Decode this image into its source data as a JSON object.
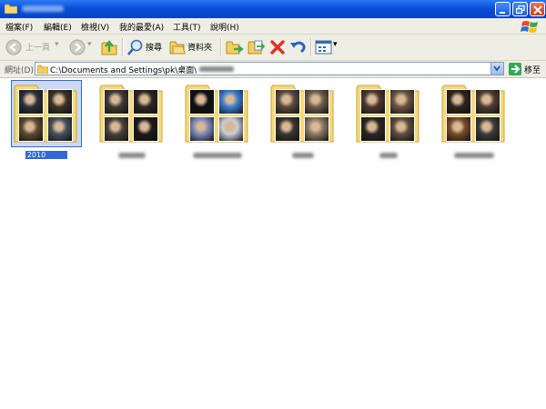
{
  "window": {
    "title": "",
    "buttons": {
      "minimize": "minimize",
      "maximize": "maximize",
      "close": "close"
    }
  },
  "menu": [
    "檔案(F)",
    "編輯(E)",
    "檢視(V)",
    "我的最愛(A)",
    "工具(T)",
    "說明(H)"
  ],
  "toolbar": {
    "back_label": "上一頁",
    "search_label": "搜尋",
    "folders_label": "資料夾"
  },
  "address": {
    "label": "網址(D)",
    "path": "C:\\Documents and Settings\\pk\\桌面\\",
    "go_label": "移至"
  },
  "folders": [
    {
      "label": "2010",
      "selected": true,
      "thumbs": [
        "#2b2f3a",
        "#3a3228",
        "#5c4a30",
        "#44505c"
      ]
    },
    {
      "label": "",
      "selected": false,
      "thumbs": [
        "#3d3a36",
        "#2a2724",
        "#4a4038",
        "#1c1a19"
      ]
    },
    {
      "label": "",
      "selected": false,
      "thumbs": [
        "#0f1014",
        "#3b7fd0",
        "#7c88b8",
        "#c8ccd8"
      ]
    },
    {
      "label": "",
      "selected": false,
      "thumbs": [
        "#5a4a3e",
        "#6e5c4c",
        "#3a342e",
        "#8a7866"
      ]
    },
    {
      "label": "",
      "selected": false,
      "thumbs": [
        "#4a3a30",
        "#6a5444",
        "#2c2622",
        "#5e4c40"
      ]
    },
    {
      "label": "",
      "selected": false,
      "thumbs": [
        "#2e241c",
        "#4c3c30",
        "#7a4a2a",
        "#3a3a3a"
      ]
    }
  ],
  "colors": {
    "titlebar": "#0a4fd6",
    "chrome": "#efeee5",
    "selection": "#3168d5",
    "folder_fill": "#f5d97a"
  }
}
